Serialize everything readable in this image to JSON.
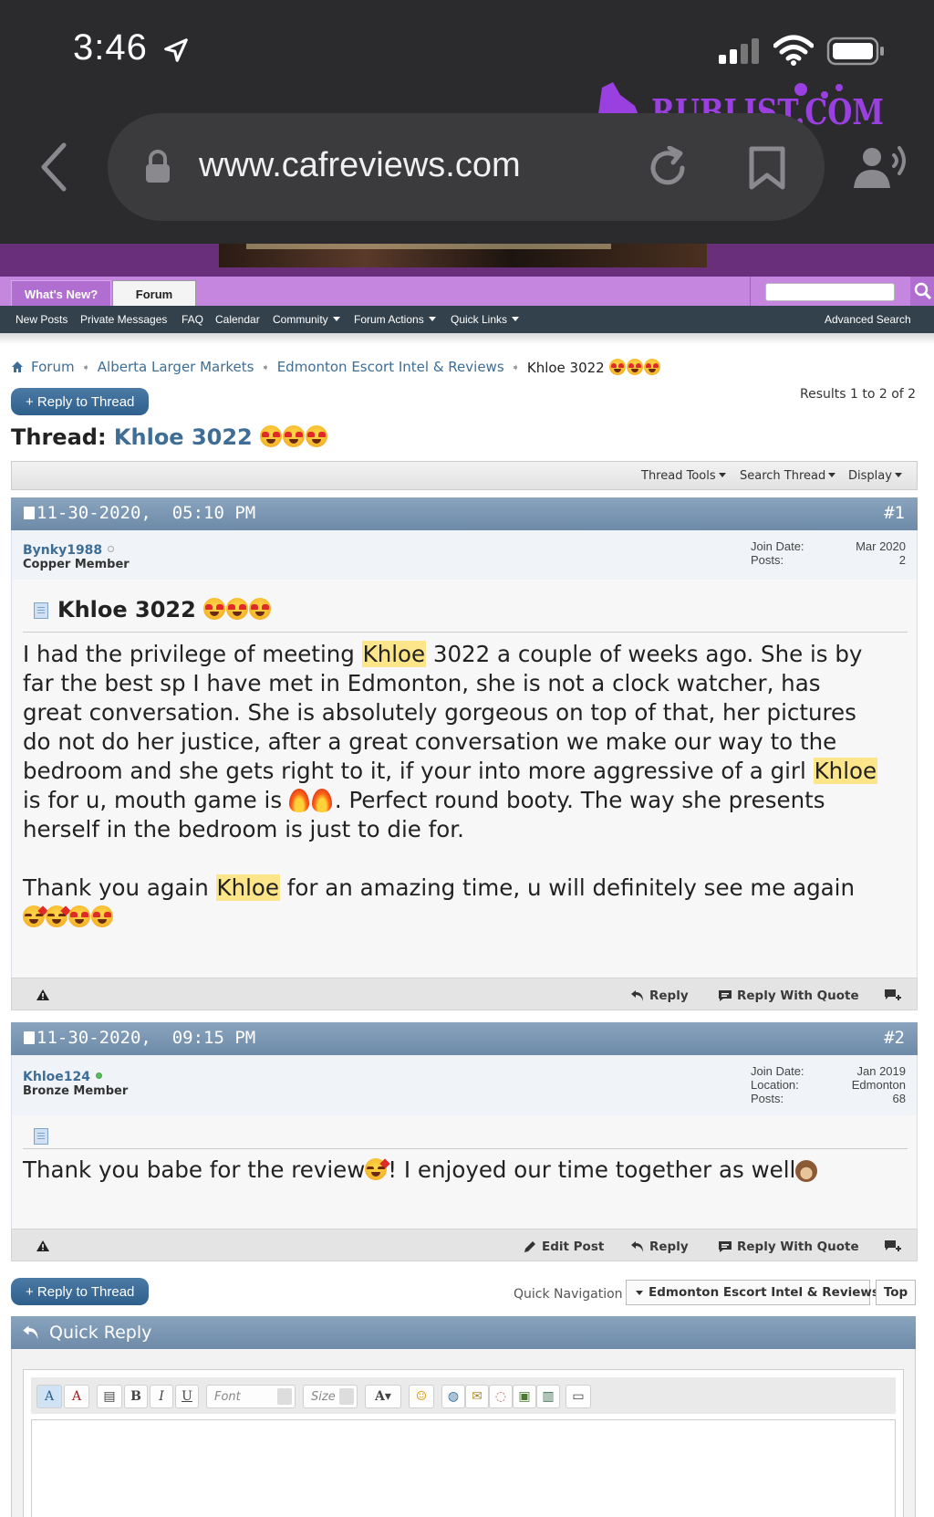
{
  "status_bar": {
    "time": "3:46"
  },
  "watermark": {
    "text": "RUBLIST.COM"
  },
  "browser": {
    "url": "www.cafreviews.com"
  },
  "navtabs": {
    "whats_new": "What's New?",
    "forum": "Forum"
  },
  "subnav": {
    "items": [
      "New Posts",
      "Private Messages",
      "FAQ",
      "Calendar",
      "Community",
      "Forum Actions",
      "Quick Links"
    ],
    "advanced_search": "Advanced Search"
  },
  "breadcrumb": {
    "items": [
      "Forum",
      "Alberta Larger Markets",
      "Edmonton Escort Intel & Reviews"
    ],
    "current": "Khloe 3022"
  },
  "thread": {
    "reply_label": "+ Reply to Thread",
    "results": "Results 1 to 2 of 2",
    "title_prefix": "Thread:",
    "title": "Khloe 3022",
    "tools": [
      "Thread Tools",
      "Search Thread",
      "Display"
    ]
  },
  "posts": [
    {
      "date": "11-30-2020,",
      "time": "05:10 PM",
      "number": "#1",
      "username": "Bynky1988",
      "rank": "Copper Member",
      "info_labels": [
        "Join Date:",
        "Posts:"
      ],
      "info_values": [
        "Mar 2020",
        "2"
      ],
      "title": "Khloe 3022",
      "body": {
        "l1a": "I had the privilege of meeting ",
        "khloe": "Khloe",
        "l1b": " 3022 a couple of weeks ago. She is by",
        "l2": "far the best sp I have met in Edmonton, she is not a clock watcher, has",
        "l3": "great conversation. She is absolutely gorgeous on top of that, her pictures",
        "l4": "do not do her justice, after a great conversation we make our way to the",
        "l5a": "bedroom and she gets right to it, if your into more aggressive of a girl ",
        "l6a": "is for u, mouth game is ",
        "l6b": ". Perfect round booty. The way she presents",
        "l7": "herself in the bedroom is just to die for.",
        "l8a": "Thank you again ",
        "l8b": " for an amazing time, u will definitely see me again"
      },
      "actions": [
        "Reply",
        "Reply With Quote"
      ]
    },
    {
      "date": "11-30-2020,",
      "time": "09:15 PM",
      "number": "#2",
      "username": "Khloe124",
      "rank": "Bronze Member",
      "info_labels": [
        "Join Date:",
        "Location:",
        "Posts:"
      ],
      "info_values": [
        "Jan 2019",
        "Edmonton",
        "68"
      ],
      "body": {
        "a": "Thank you babe for the review",
        "b": "! I enjoyed our time together as well"
      },
      "actions": [
        "Edit Post",
        "Reply",
        "Reply With Quote"
      ]
    }
  ],
  "bottom": {
    "reply_label": "+ Reply to Thread",
    "quick_nav_label": "Quick Navigation",
    "quick_nav_value": "Edmonton Escort Intel & Reviews",
    "top": "Top"
  },
  "quick_reply": {
    "title": "Quick Reply",
    "font_placeholder": "Font",
    "size_placeholder": "Size"
  }
}
